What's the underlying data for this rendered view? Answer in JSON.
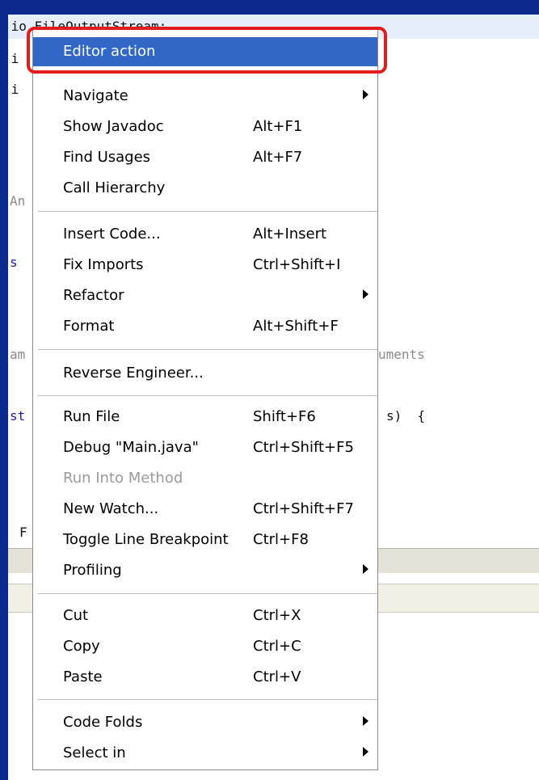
{
  "code_lines": [
    ".io.FileOutputStream;",
    ".i",
    ".i",
    "An",
    "s",
    "am",
    "uments",
    "st",
    "s)  {",
    "F"
  ],
  "menu": {
    "items": [
      {
        "label": "Editor action",
        "shortcut": "",
        "submenu": false,
        "state": "selected"
      },
      {
        "label": "Navigate",
        "shortcut": "",
        "submenu": true
      },
      {
        "label": "Show Javadoc",
        "shortcut": "Alt+F1",
        "submenu": false
      },
      {
        "label": "Find Usages",
        "shortcut": "Alt+F7",
        "submenu": false
      },
      {
        "label": "Call Hierarchy",
        "shortcut": "",
        "submenu": false
      },
      {
        "label": "Insert Code...",
        "shortcut": "Alt+Insert",
        "submenu": false
      },
      {
        "label": "Fix Imports",
        "shortcut": "Ctrl+Shift+I",
        "submenu": false
      },
      {
        "label": "Refactor",
        "shortcut": "",
        "submenu": true
      },
      {
        "label": "Format",
        "shortcut": "Alt+Shift+F",
        "submenu": false
      },
      {
        "label": "Reverse Engineer...",
        "shortcut": "",
        "submenu": false
      },
      {
        "label": "Run File",
        "shortcut": "Shift+F6",
        "submenu": false
      },
      {
        "label": "Debug \"Main.java\"",
        "shortcut": "Ctrl+Shift+F5",
        "submenu": false
      },
      {
        "label": "Run Into Method",
        "shortcut": "",
        "submenu": false,
        "state": "disabled"
      },
      {
        "label": "New Watch...",
        "shortcut": "Ctrl+Shift+F7",
        "submenu": false
      },
      {
        "label": "Toggle Line Breakpoint",
        "shortcut": "Ctrl+F8",
        "submenu": false
      },
      {
        "label": "Profiling",
        "shortcut": "",
        "submenu": true
      },
      {
        "label": "Cut",
        "shortcut": "Ctrl+X",
        "submenu": false
      },
      {
        "label": "Copy",
        "shortcut": "Ctrl+C",
        "submenu": false
      },
      {
        "label": "Paste",
        "shortcut": "Ctrl+V",
        "submenu": false
      },
      {
        "label": "Code Folds",
        "shortcut": "",
        "submenu": true
      },
      {
        "label": "Select in",
        "shortcut": "",
        "submenu": true
      }
    ]
  },
  "colors": {
    "selection": "#3168c8",
    "highlight_outline": "#e11d1d",
    "desktop_blue": "#0a2a8e"
  }
}
